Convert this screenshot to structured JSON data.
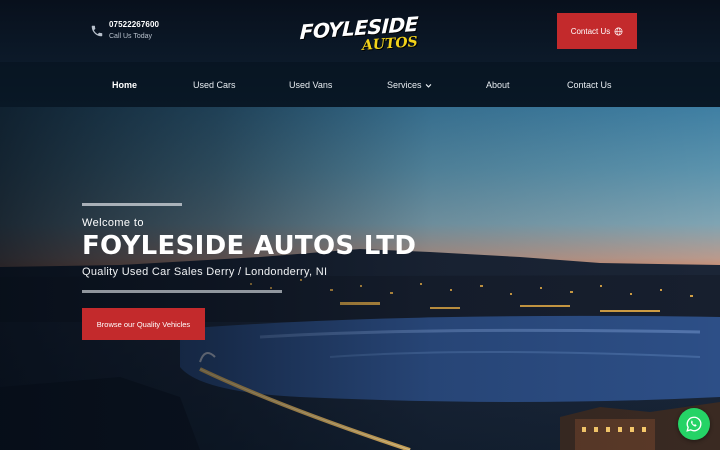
{
  "header": {
    "phone_number": "07522267600",
    "phone_caption": "Call Us Today",
    "logo_line1": "FOYLESIDE",
    "logo_line2": "AUTOS",
    "contact_button_label": "Contact Us"
  },
  "nav": {
    "items": [
      {
        "label": "Home",
        "active": true
      },
      {
        "label": "Used Cars"
      },
      {
        "label": "Used Vans"
      },
      {
        "label": "Services",
        "dropdown": true
      },
      {
        "label": "About"
      },
      {
        "label": "Contact Us"
      }
    ]
  },
  "hero": {
    "welcome": "Welcome to",
    "title": "FOYLESIDE AUTOS LTD",
    "subtitle": "Quality Used Car Sales Derry / Londonderry, NI",
    "cta_label": "Browse our Quality Vehicles"
  },
  "colors": {
    "accent_red": "#c32a2c",
    "logo_yellow": "#f2d21a",
    "whatsapp_green": "#25d366",
    "header_bg": "#0c1a2a"
  },
  "icons": {
    "phone": "phone-icon",
    "contact": "globe-icon",
    "services_dropdown": "chevron-down-icon",
    "whatsapp": "whatsapp-icon"
  }
}
